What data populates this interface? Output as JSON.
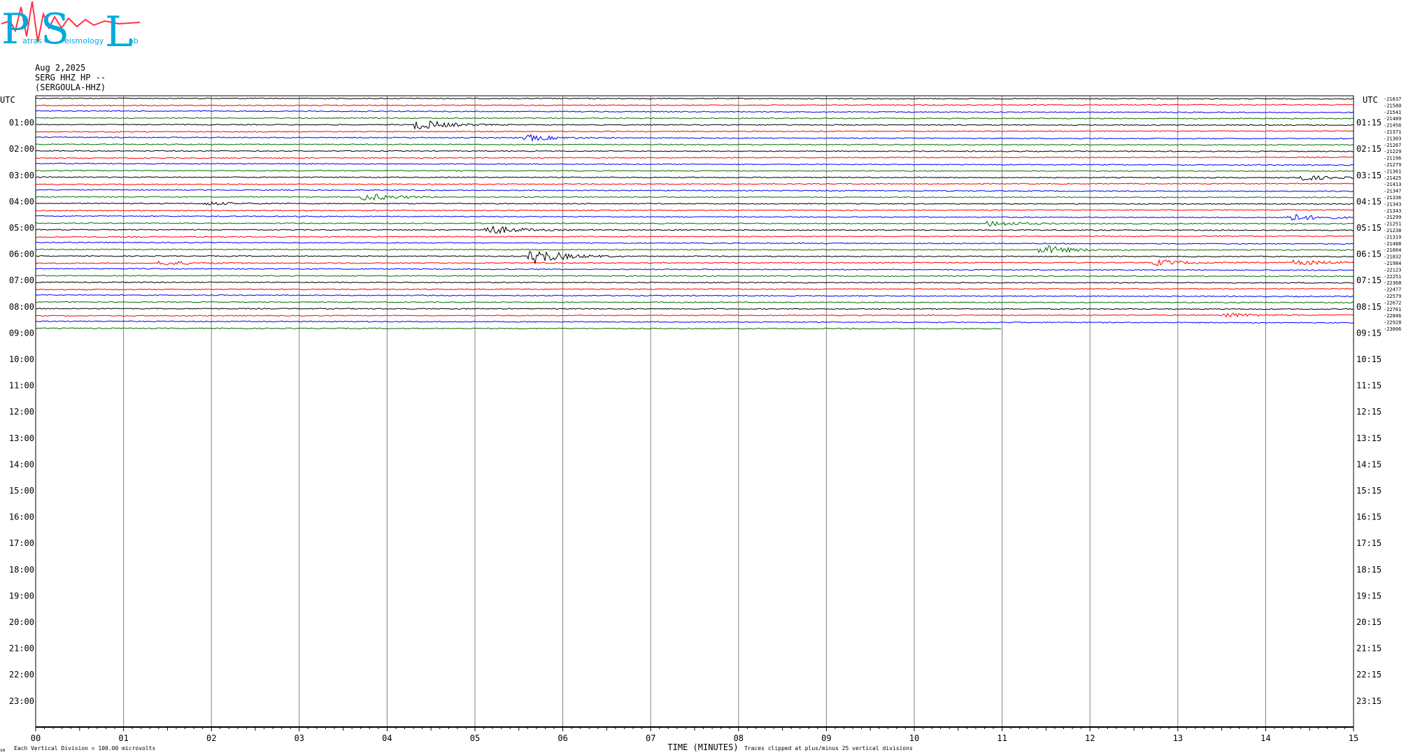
{
  "logo": {
    "letters": [
      "P",
      "S",
      "L"
    ],
    "words": [
      "atras",
      "eismology",
      "ab"
    ]
  },
  "header": {
    "date": "Aug 2,2025",
    "channel": "SERG HHZ HP --",
    "station": "(SERGOULA-HHZ)"
  },
  "colors": {
    "trace_cycle": [
      "#000000",
      "#ff0000",
      "#0000ff",
      "#007000"
    ],
    "grid": "#808080",
    "logo_text": "#00aadd",
    "logo_wave": "#ff3344"
  },
  "chart_data": {
    "type": "helicorder",
    "xlabel": "TIME (MINUTES)",
    "x_ticks": [
      "00",
      "01",
      "02",
      "03",
      "04",
      "05",
      "06",
      "07",
      "08",
      "09",
      "10",
      "11",
      "12",
      "13",
      "14",
      "15"
    ],
    "x_range": [
      0,
      15
    ],
    "left_axis_title": "UTC",
    "right_axis_title": "UTC",
    "left_hours": [
      "01:00",
      "02:00",
      "03:00",
      "04:00",
      "05:00",
      "06:00",
      "07:00",
      "08:00",
      "09:00",
      "10:00",
      "11:00",
      "12:00",
      "13:00",
      "14:00",
      "15:00",
      "16:00",
      "17:00",
      "18:00",
      "19:00",
      "20:00",
      "21:00",
      "22:00",
      "23:00"
    ],
    "right_hours": [
      "01:15",
      "02:15",
      "03:15",
      "04:15",
      "05:15",
      "06:15",
      "07:15",
      "08:15",
      "09:15",
      "10:15",
      "11:15",
      "12:15",
      "13:15",
      "14:15",
      "15:15",
      "16:15",
      "17:15",
      "18:15",
      "19:15",
      "20:15",
      "21:15",
      "22:15",
      "23:15"
    ],
    "trace_interval_minutes": 15,
    "traces_recorded": 36,
    "last_trace_end_minute": 11,
    "trace_offsets": [
      "-21637",
      "-21580",
      "-21541",
      "-21489",
      "-21456",
      "-21371",
      "-21303",
      "-21267",
      "-21229",
      "-21196",
      "-21279",
      "-21361",
      "-21425",
      "-21413",
      "-21347",
      "-21336",
      "-21343",
      "-21343",
      "-21299",
      "-21251",
      "-21238",
      "-21319",
      "-21488",
      "-21664",
      "-21832",
      "-21984",
      "-22123",
      "-22251",
      "-22368",
      "-22477",
      "-22579",
      "-22672",
      "-22761",
      "-22846",
      "-22928",
      "-23006"
    ],
    "events": [
      {
        "trace": 4,
        "minute": 4.4,
        "amp": 7
      },
      {
        "trace": 6,
        "minute": 5.65,
        "amp": 4
      },
      {
        "trace": 12,
        "minute": 14.4,
        "amp": 4
      },
      {
        "trace": 15,
        "minute": 3.8,
        "amp": 5
      },
      {
        "trace": 16,
        "minute": 2.0,
        "amp": 2
      },
      {
        "trace": 18,
        "minute": 14.3,
        "amp": 5
      },
      {
        "trace": 19,
        "minute": 10.9,
        "amp": 4
      },
      {
        "trace": 20,
        "minute": 5.2,
        "amp": 6
      },
      {
        "trace": 23,
        "minute": 11.5,
        "amp": 6
      },
      {
        "trace": 24,
        "minute": 5.7,
        "amp": 11
      },
      {
        "trace": 25,
        "minute": 1.5,
        "amp": 3
      },
      {
        "trace": 25,
        "minute": 12.8,
        "amp": 4
      },
      {
        "trace": 25,
        "minute": 14.4,
        "amp": 4
      },
      {
        "trace": 33,
        "minute": 13.6,
        "amp": 3
      }
    ],
    "footer_left": "Each Vertical Division =  100.00 microvolts",
    "footer_right": "Traces clipped at plus/minus 25 vertical divisions",
    "corner_mark": "sm"
  }
}
